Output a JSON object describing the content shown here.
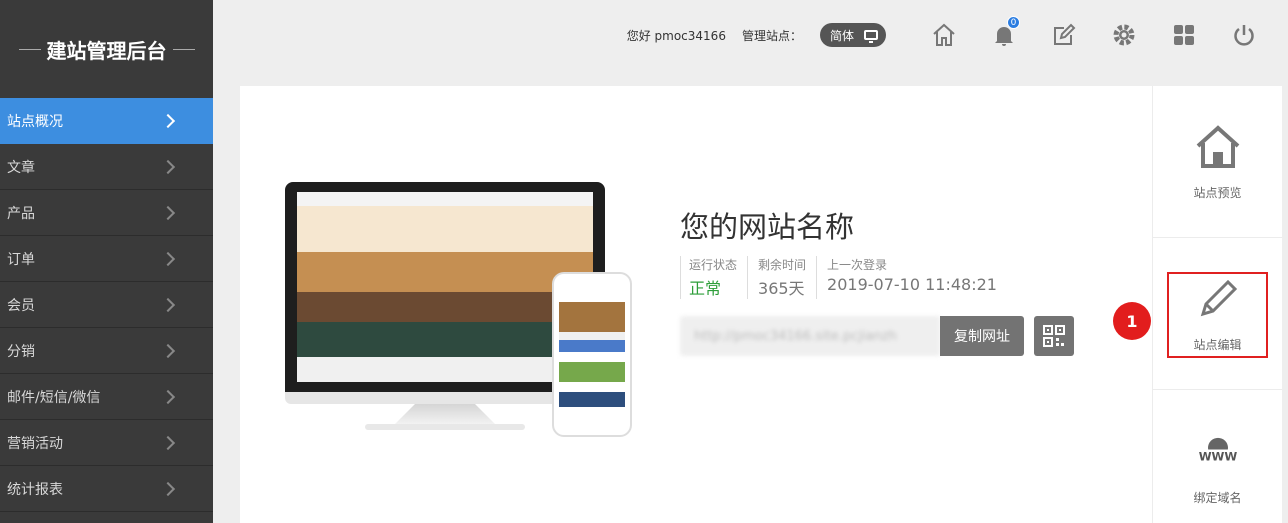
{
  "sidebar": {
    "brand": "建站管理后台",
    "items": [
      {
        "label": "站点概况",
        "active": true
      },
      {
        "label": "文章"
      },
      {
        "label": "产品"
      },
      {
        "label": "订单"
      },
      {
        "label": "会员"
      },
      {
        "label": "分销"
      },
      {
        "label": "邮件/短信/微信"
      },
      {
        "label": "营销活动"
      },
      {
        "label": "统计报表"
      }
    ]
  },
  "topbar": {
    "greeting": "您好 pmoc34166",
    "manage_label": "管理站点：",
    "lang": "简体",
    "notification_count": "0",
    "icons": [
      "home-icon",
      "bell-icon",
      "edit-icon",
      "gear-icon",
      "grid-icon",
      "power-icon"
    ]
  },
  "site": {
    "title": "您的网站名称",
    "stats": [
      {
        "label": "运行状态",
        "value": "正常"
      },
      {
        "label": "剩余时间",
        "value": "365天"
      },
      {
        "label": "上一次登录",
        "value": "2019-07-10 11:48:21"
      }
    ],
    "url_blurred": "http://pmoc34166.site.pcjianzh",
    "copy_label": "复制网址"
  },
  "right_panel": [
    {
      "label": "站点预览",
      "icon": "house-icon"
    },
    {
      "label": "站点编辑",
      "icon": "pencil-icon"
    },
    {
      "label": "绑定域名",
      "icon": "www-icon"
    }
  ],
  "annotation": {
    "number": "1"
  },
  "colors": {
    "sidebar_bg": "#3a3a3a",
    "active": "#3d8ee0",
    "status_ok": "#2e9e3a",
    "highlight": "#e02020"
  }
}
